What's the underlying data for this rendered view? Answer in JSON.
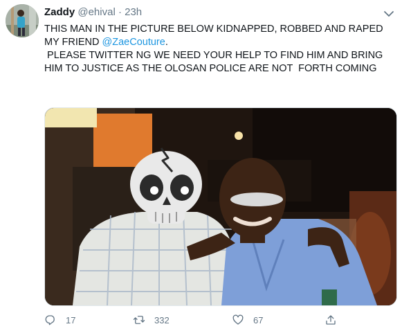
{
  "tweet": {
    "display_name": "Zaddy",
    "handle": "@ehival",
    "separator": "·",
    "time": "23h",
    "text_before_mention": "THIS MAN IN THE PICTURE BELOW KIDNAPPED, ROBBED AND RAPED MY FRIEND ",
    "mention": "@ZaeCouture",
    "text_after_mention": ".\n PLEASE TWITTER NG WE NEED YOUR HELP TO FIND HIM AND BRING HIM TO JUSTICE AS THE OLOSAN POLICE ARE NOT  FORTH COMING"
  },
  "actions": {
    "reply_count": "17",
    "retweet_count": "332",
    "like_count": "67"
  },
  "icons": {
    "reply": "reply-icon",
    "retweet": "retweet-icon",
    "like": "heart-icon",
    "share": "share-icon",
    "more": "chevron-down-icon",
    "skull": "skull-emoji-icon"
  },
  "colors": {
    "text": "#0f1419",
    "secondary": "#657786",
    "link": "#1b95e0"
  }
}
